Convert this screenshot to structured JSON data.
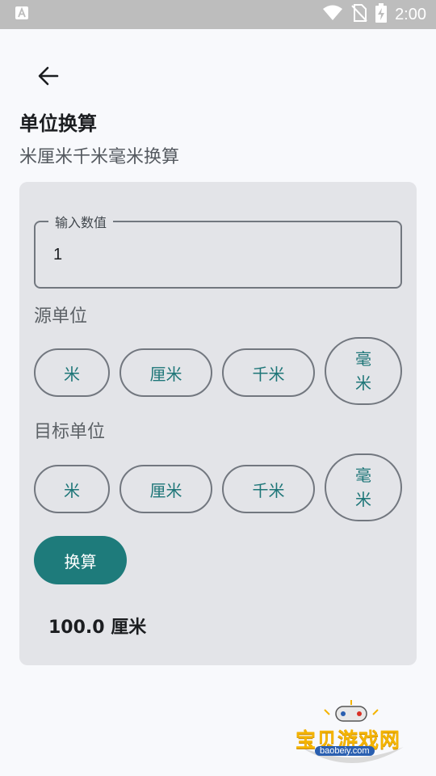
{
  "status_bar": {
    "time": "2:00",
    "icons": [
      "a11y-icon",
      "wifi-icon",
      "no-sim-icon",
      "battery-charging-icon"
    ]
  },
  "header": {
    "back_icon": "arrow-left-icon",
    "title": "单位换算",
    "subtitle": "米厘米千米毫米换算"
  },
  "form": {
    "input_label": "输入数值",
    "input_value": "1",
    "source_label": "源单位",
    "source_units": [
      "米",
      "厘米",
      "千米",
      "毫米"
    ],
    "target_label": "目标单位",
    "target_units": [
      "米",
      "厘米",
      "千米",
      "毫米"
    ],
    "convert_label": "换算",
    "result": "100.0 厘米"
  },
  "watermark": {
    "text": "宝贝游戏网",
    "url": "baobeiy.com"
  },
  "colors": {
    "accent": "#1e7b7b",
    "card_bg": "#e3e4e8",
    "status_bar": "#bdbdbd"
  }
}
